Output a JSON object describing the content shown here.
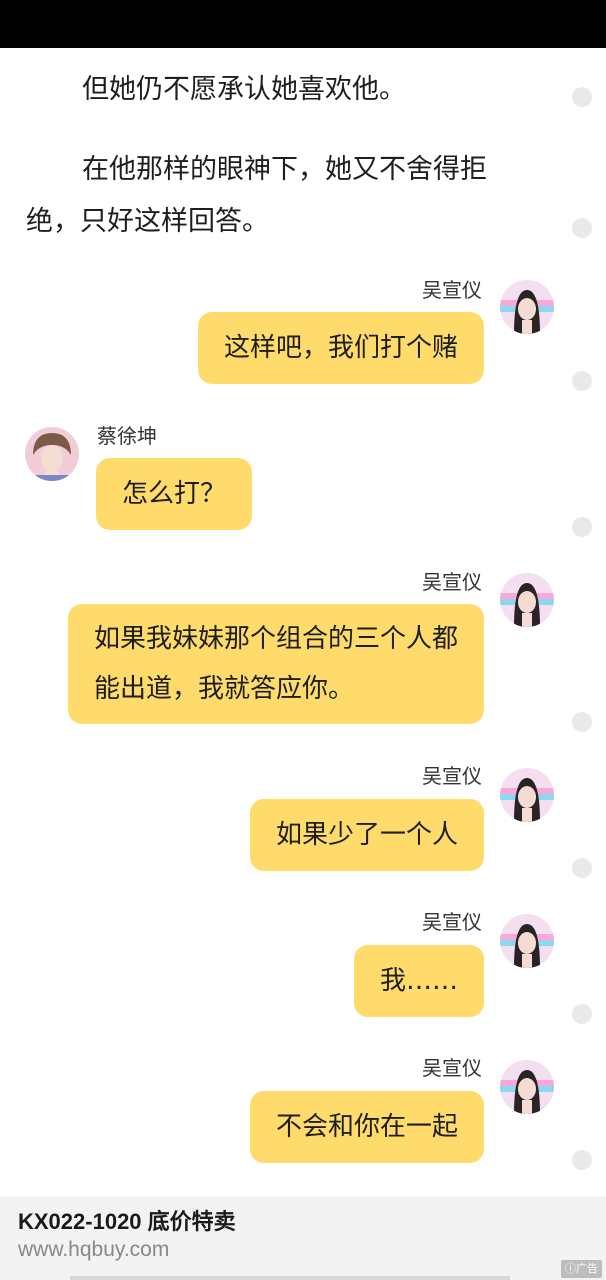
{
  "story": {
    "paragraphs": [
      "但她仍不愿承认她喜欢他。",
      "在他那样的眼神下，她又不舍得拒绝，只好这样回答。"
    ]
  },
  "chat": {
    "messages": [
      {
        "side": "right",
        "name": "吴宣仪",
        "text": "这样吧，我们打个赌",
        "avatar": "female-avatar"
      },
      {
        "side": "left",
        "name": "蔡徐坤",
        "text": "怎么打？",
        "avatar": "male-avatar"
      },
      {
        "side": "right",
        "name": "吴宣仪",
        "text": "如果我妹妹那个组合的三个人都能出道，我就答应你。",
        "avatar": "female-avatar"
      },
      {
        "side": "right",
        "name": "吴宣仪",
        "text": "如果少了一个人",
        "avatar": "female-avatar"
      },
      {
        "side": "right",
        "name": "吴宣仪",
        "text": "我……",
        "avatar": "female-avatar"
      },
      {
        "side": "right",
        "name": "吴宣仪",
        "text": "不会和你在一起",
        "avatar": "female-avatar"
      }
    ]
  },
  "ad": {
    "title": "KX022-1020 底价特卖",
    "url": "www.hqbuy.com",
    "badge": "广告",
    "badge_icon": "ad-info-icon"
  },
  "colors": {
    "bubble": "#fedb6b",
    "status_bar": "#000000",
    "ad_background": "#f3f3f3"
  }
}
